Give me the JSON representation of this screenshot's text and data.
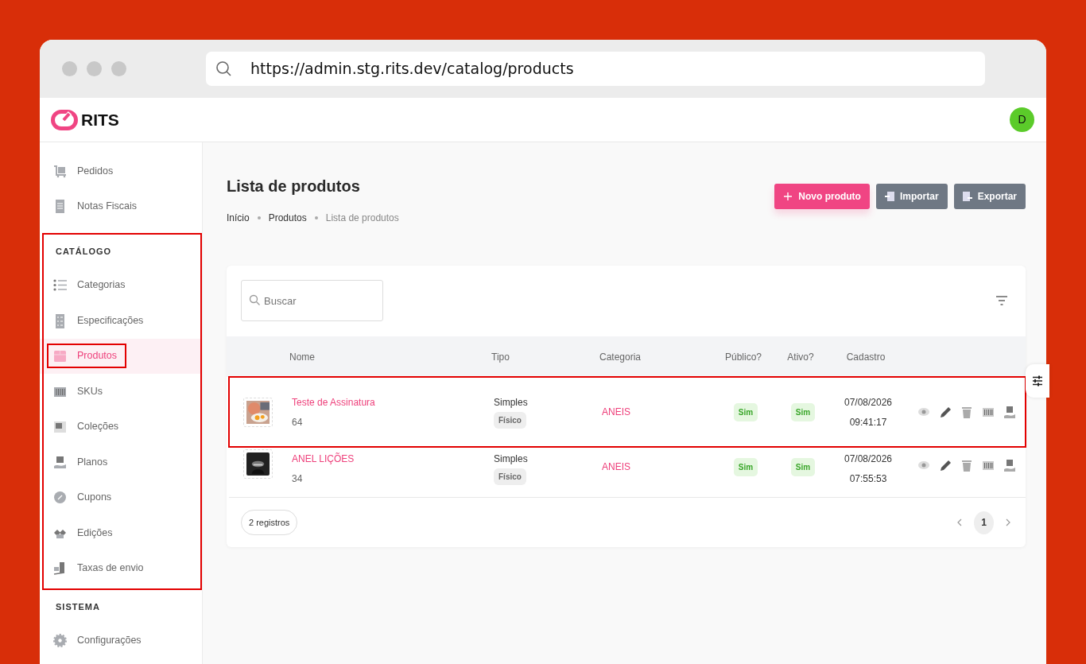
{
  "browser": {
    "url": "https://admin.stg.rits.dev/catalog/products"
  },
  "header": {
    "logo": "RITS",
    "avatar": "D"
  },
  "sidebar": {
    "sections": [
      {
        "highlighted": false,
        "items": [
          {
            "label": "Pedidos",
            "selected": false,
            "highlighted": false
          },
          {
            "label": "Notas Fiscais",
            "selected": false,
            "highlighted": false
          }
        ]
      },
      {
        "title": "CATÁLOGO",
        "highlighted": true,
        "items": [
          {
            "label": "Categorias",
            "selected": false,
            "highlighted": false
          },
          {
            "label": "Especificações",
            "selected": false,
            "highlighted": false
          },
          {
            "label": "Produtos",
            "selected": true,
            "highlighted": true
          },
          {
            "label": "SKUs",
            "selected": false,
            "highlighted": false
          },
          {
            "label": "Coleções",
            "selected": false,
            "highlighted": false
          },
          {
            "label": "Planos",
            "selected": false,
            "highlighted": false
          },
          {
            "label": "Cupons",
            "selected": false,
            "highlighted": false
          },
          {
            "label": "Edições",
            "selected": false,
            "highlighted": false
          },
          {
            "label": "Taxas de envio",
            "selected": false,
            "highlighted": false
          }
        ]
      },
      {
        "title": "SISTEMA",
        "highlighted": false,
        "items": [
          {
            "label": "Configurações",
            "selected": false,
            "highlighted": false
          }
        ]
      }
    ]
  },
  "page": {
    "title": "Lista de produtos",
    "breadcrumb": [
      "Início",
      "Produtos",
      "Lista de produtos"
    ],
    "buttons": [
      {
        "label": "Novo produto",
        "kind": "primary"
      },
      {
        "label": "Importar",
        "kind": "import"
      },
      {
        "label": "Exportar",
        "kind": "export"
      }
    ]
  },
  "table": {
    "search": {
      "placeholder": "Buscar"
    },
    "columns": [
      "Nome",
      "Tipo",
      "Categoria",
      "Público?",
      "Ativo?",
      "Cadastro"
    ],
    "rows": [
      {
        "name": "Teste de Assinatura",
        "code": "64",
        "type": "Simples",
        "tag": "Físico",
        "category": "ANEIS",
        "public": "Sim",
        "active": "Sim",
        "date": "07/08/2026",
        "time": "09:41:17",
        "highlighted": true
      },
      {
        "name": "ANEL LIÇÕES",
        "code": "34",
        "type": "Simples",
        "tag": "Físico",
        "category": "ANEIS",
        "public": "Sim",
        "active": "Sim",
        "date": "07/08/2026",
        "time": "07:55:53",
        "highlighted": false
      }
    ],
    "count": "2 registros",
    "pages": [
      {
        "label": "1",
        "selected": true
      }
    ]
  }
}
